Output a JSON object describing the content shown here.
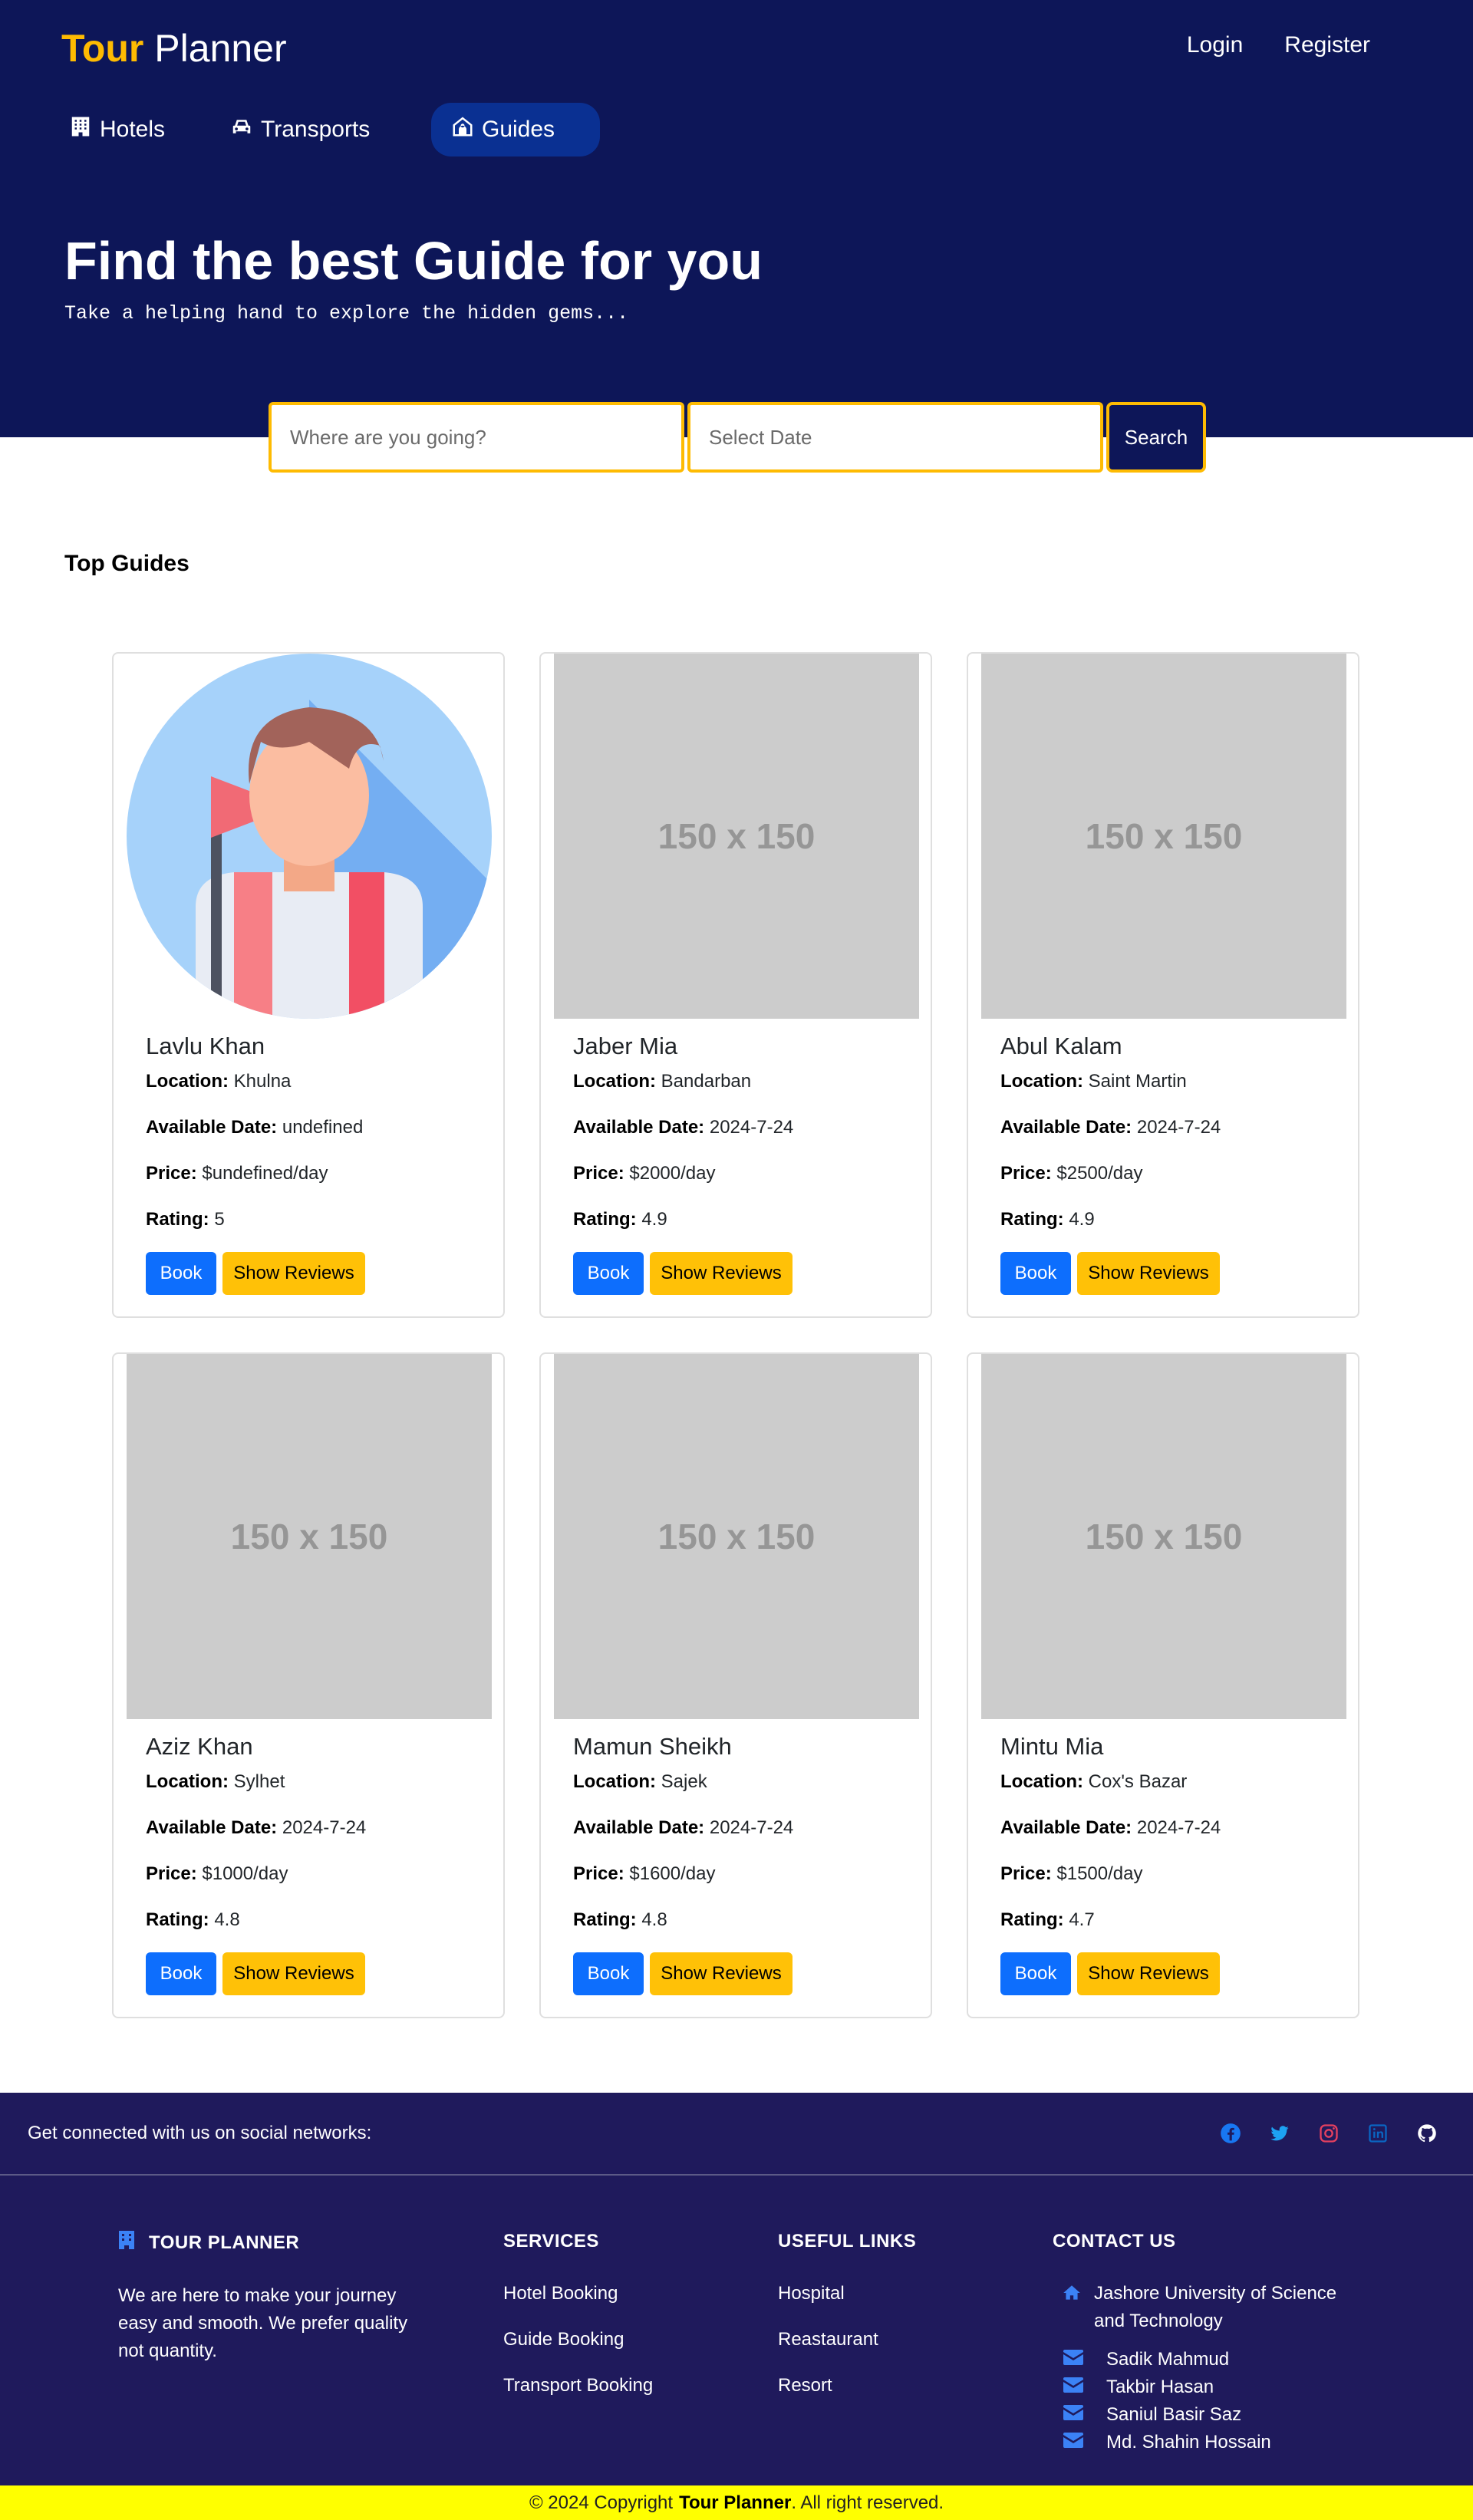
{
  "brand": {
    "part1": "Tour",
    "part2": "Planner"
  },
  "auth": {
    "login": "Login",
    "register": "Register"
  },
  "nav": {
    "tabs": [
      {
        "label": "Hotels",
        "icon": "hotel-icon"
      },
      {
        "label": "Transports",
        "icon": "car-icon"
      },
      {
        "label": "Guides",
        "icon": "guide-icon",
        "active": true
      }
    ]
  },
  "hero": {
    "title": "Find the best Guide for you",
    "subtitle": "Take a helping hand to explore the hidden gems..."
  },
  "search": {
    "destination_placeholder": "Where are you going?",
    "date_placeholder": "Select Date",
    "button": "Search"
  },
  "section": {
    "title": "Top Guides"
  },
  "labels": {
    "location": "Location:",
    "date": "Available Date:",
    "price": "Price:",
    "rating": "Rating:",
    "book": "Book",
    "reviews": "Show Reviews",
    "placeholder": "150 x 150"
  },
  "guides": [
    {
      "name": "Lavlu Khan",
      "location": "Khulna",
      "date": "undefined",
      "price": "$undefined/day",
      "rating": "5",
      "avatar": "guide-avatar-illustration"
    },
    {
      "name": "Jaber Mia",
      "location": "Bandarban",
      "date": "2024-7-24",
      "price": "$2000/day",
      "rating": "4.9"
    },
    {
      "name": "Abul Kalam",
      "location": "Saint Martin",
      "date": "2024-7-24",
      "price": "$2500/day",
      "rating": "4.9"
    },
    {
      "name": "Aziz Khan",
      "location": "Sylhet",
      "date": "2024-7-24",
      "price": "$1000/day",
      "rating": "4.8"
    },
    {
      "name": "Mamun Sheikh",
      "location": "Sajek",
      "date": "2024-7-24",
      "price": "$1600/day",
      "rating": "4.8"
    },
    {
      "name": "Mintu Mia",
      "location": "Cox's Bazar",
      "date": "2024-7-24",
      "price": "$1500/day",
      "rating": "4.7"
    }
  ],
  "footer": {
    "social_text": "Get connected with us on social networks:",
    "social_icons": [
      "facebook-icon",
      "twitter-icon",
      "instagram-icon",
      "linkedin-icon",
      "github-icon"
    ],
    "about": {
      "title": "TOUR PLANNER",
      "text": "We are here to make your journey easy and smooth. We prefer quality not quantity."
    },
    "services": {
      "title": "SERVICES",
      "items": [
        "Hotel Booking",
        "Guide Booking",
        "Transport Booking"
      ]
    },
    "links": {
      "title": "USEFUL LINKS",
      "items": [
        "Hospital",
        "Reastaurant",
        "Resort"
      ]
    },
    "contact": {
      "title": "CONTACT US",
      "address": "Jashore University of Science and Technology",
      "people": [
        "Sadik Mahmud",
        "Takbir Hasan",
        "Saniul Basir Saz",
        "Md. Shahin Hossain"
      ]
    }
  },
  "copyright": {
    "prefix": "© 2024 Copyright",
    "brand": "Tour Planner",
    "suffix": ". All right reserved."
  },
  "colors": {
    "header_bg": "#0d1658",
    "accent_yellow": "#febb02",
    "active_tab": "#0a3092",
    "footer_bg": "#1f1a5c",
    "book_button": "#0d6efd",
    "reviews_button": "#ffc107",
    "copyright_bg": "#ffff00"
  }
}
